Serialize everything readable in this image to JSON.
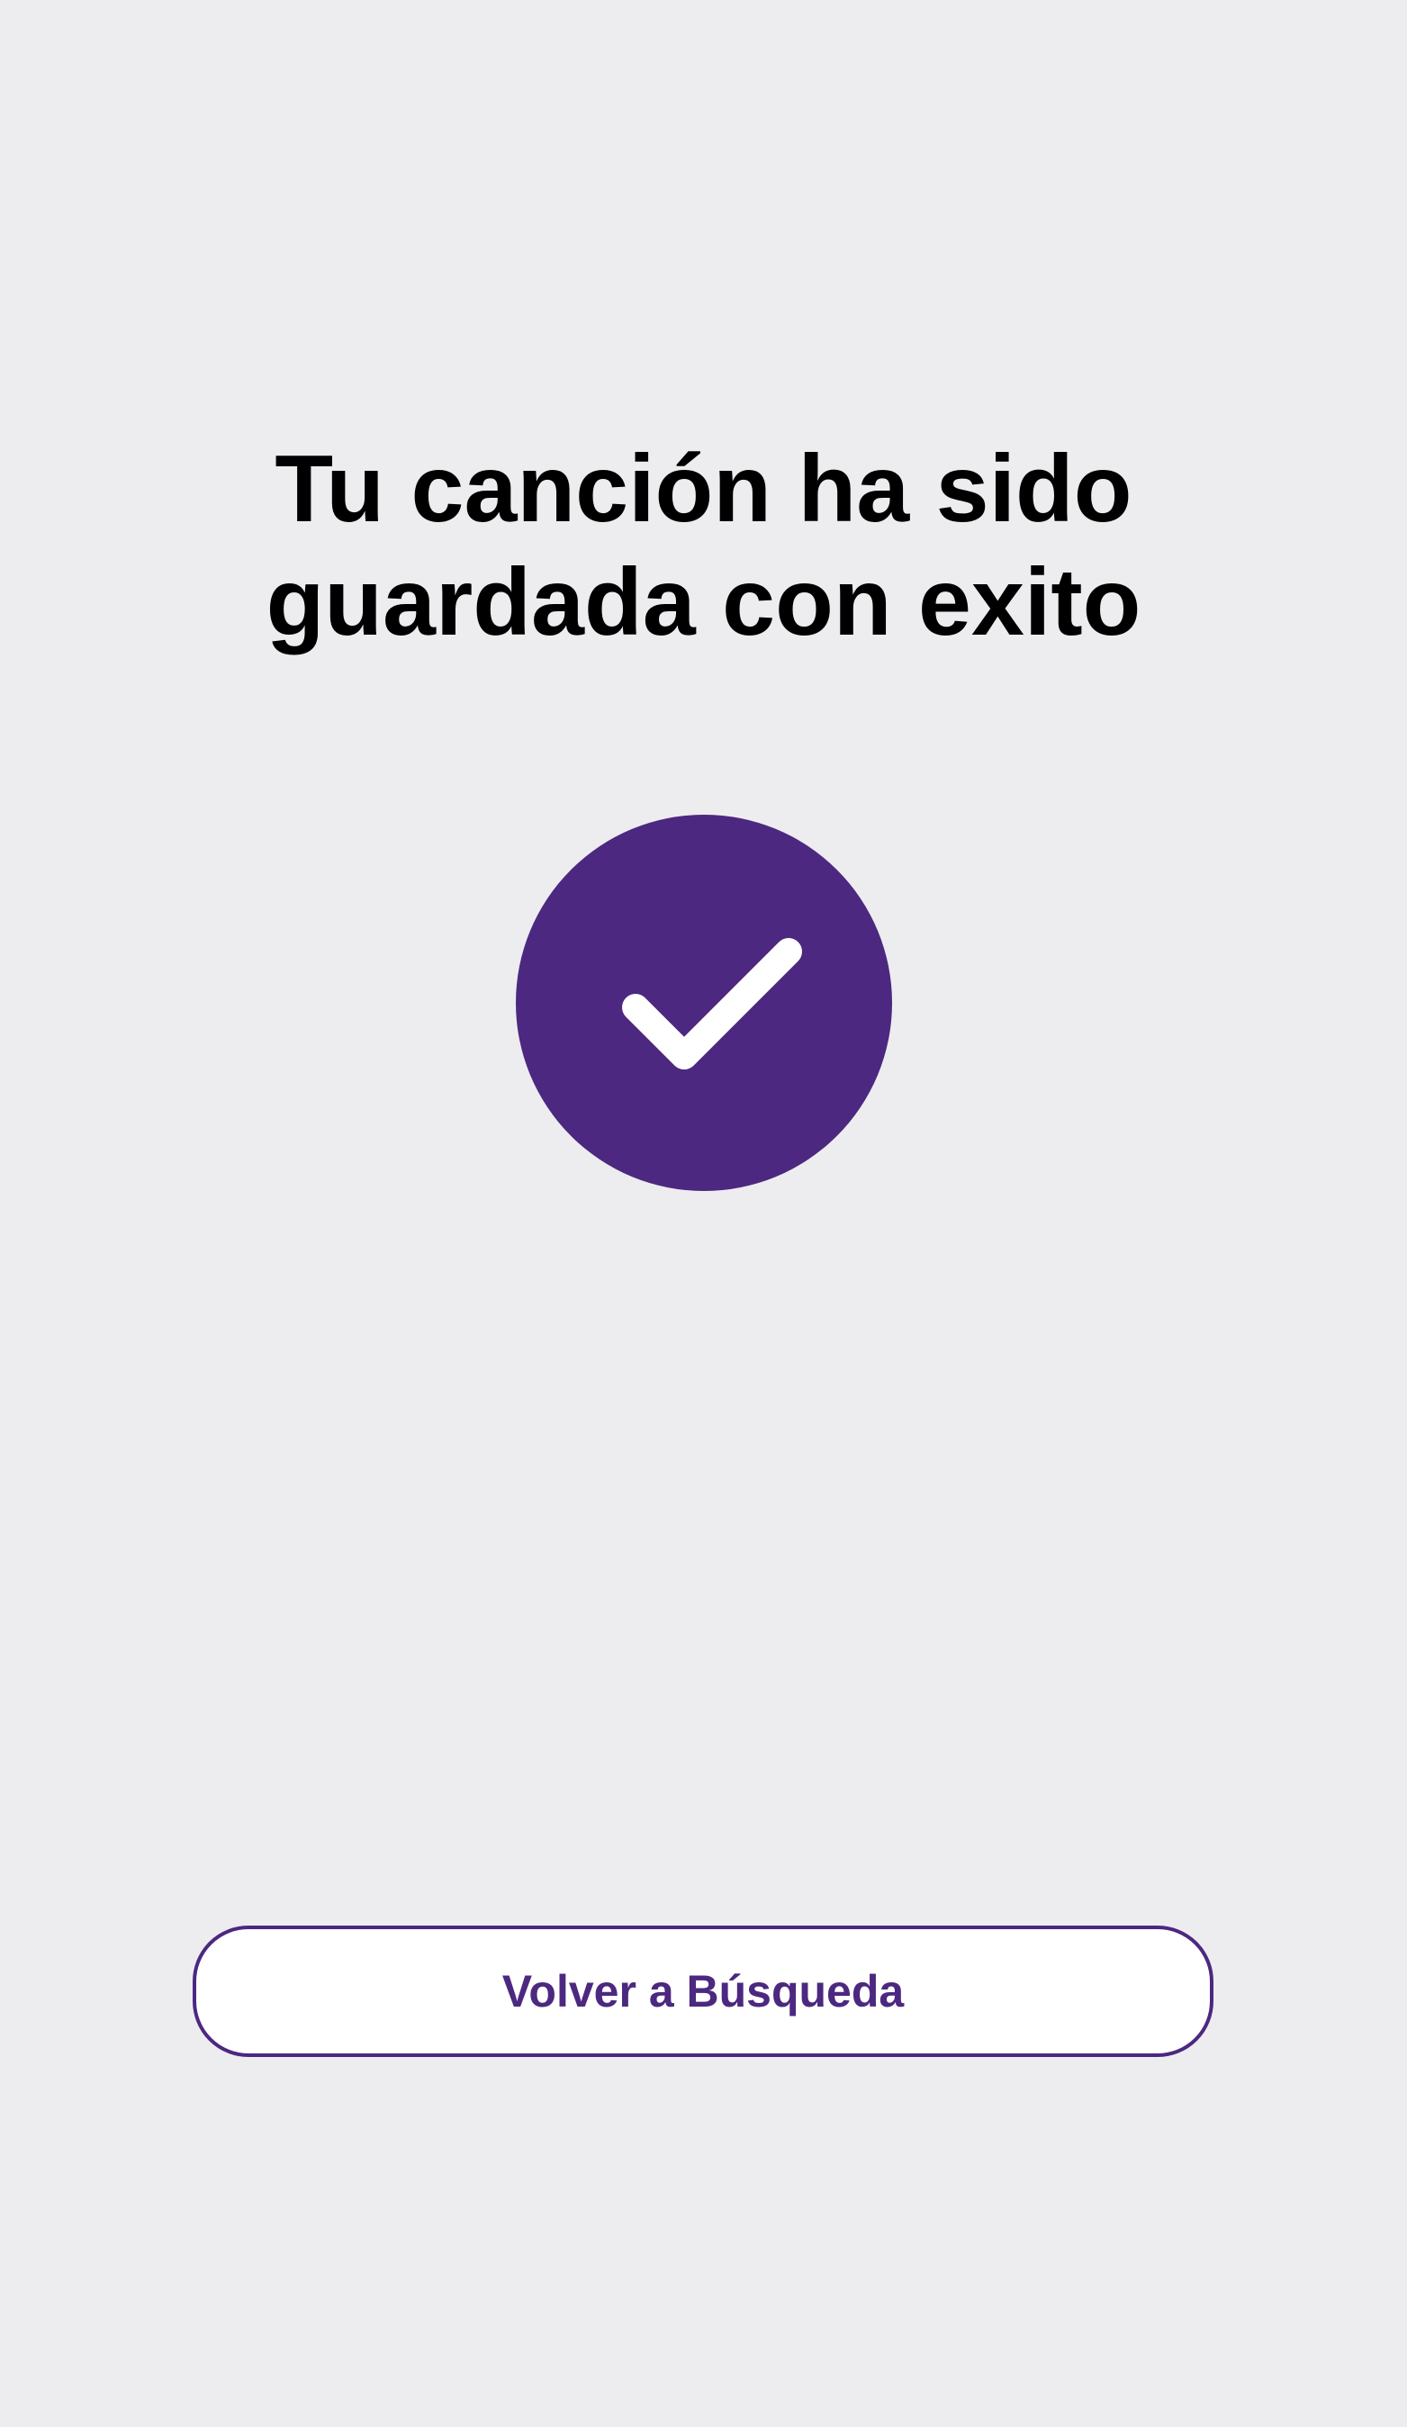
{
  "confirmation": {
    "title_line_1": "Tu canción ha sido",
    "title_line_2": "guardada con exito",
    "icon": "checkmark-circle-icon"
  },
  "actions": {
    "back_to_search_label": "Volver a Búsqueda"
  },
  "colors": {
    "background": "#ededf0",
    "accent": "#4c2880",
    "check": "#ffffff",
    "title_text": "#000000"
  }
}
